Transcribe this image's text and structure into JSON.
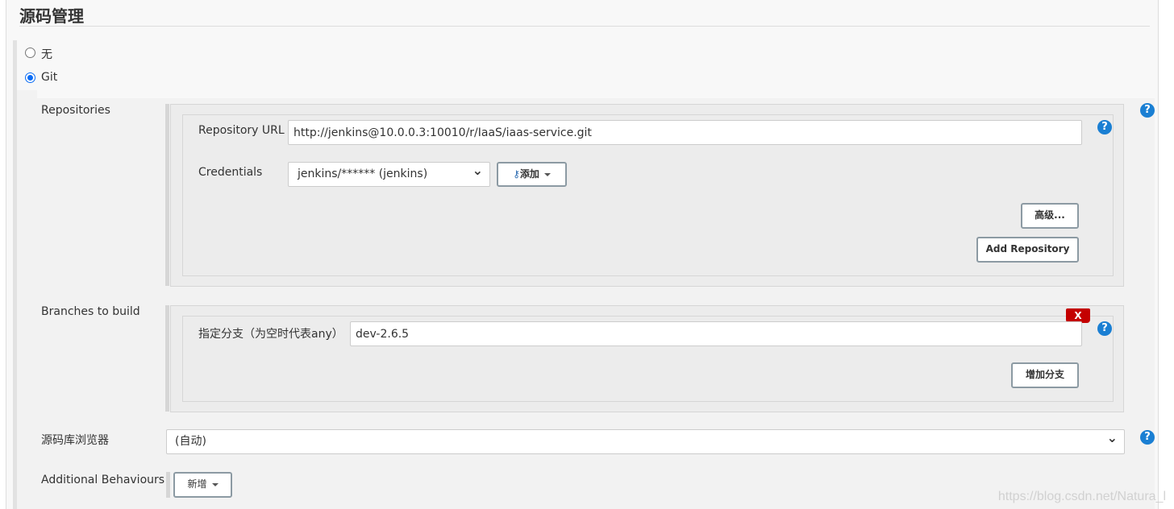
{
  "section_title": "源码管理",
  "scm_options": [
    {
      "label": "无",
      "selected": false
    },
    {
      "label": "Git",
      "selected": true
    }
  ],
  "repositories": {
    "label": "Repositories",
    "url_label": "Repository URL",
    "url_value": "http://jenkins@10.0.0.3:10010/r/IaaS/iaas-service.git",
    "credentials_label": "Credentials",
    "credentials_value": "jenkins/****** (jenkins)",
    "add_label": "添加",
    "advanced_label": "高级...",
    "add_repo_label": "Add Repository"
  },
  "branches": {
    "label": "Branches to build",
    "spec_label": "指定分支（为空时代表any）",
    "spec_value": "dev-2.6.5",
    "delete_label": "X",
    "add_branch_label": "增加分支"
  },
  "browser": {
    "label": "源码库浏览器",
    "value": "(自动)"
  },
  "behaviours": {
    "label": "Additional Behaviours",
    "add_label": "新增"
  },
  "help_glyph": "?",
  "watermark": "https://blog.csdn.net/Natura_l",
  "colors": {
    "accent": "#1a7fd3",
    "delete": "#c40000",
    "radio": "#0a6cf5"
  }
}
